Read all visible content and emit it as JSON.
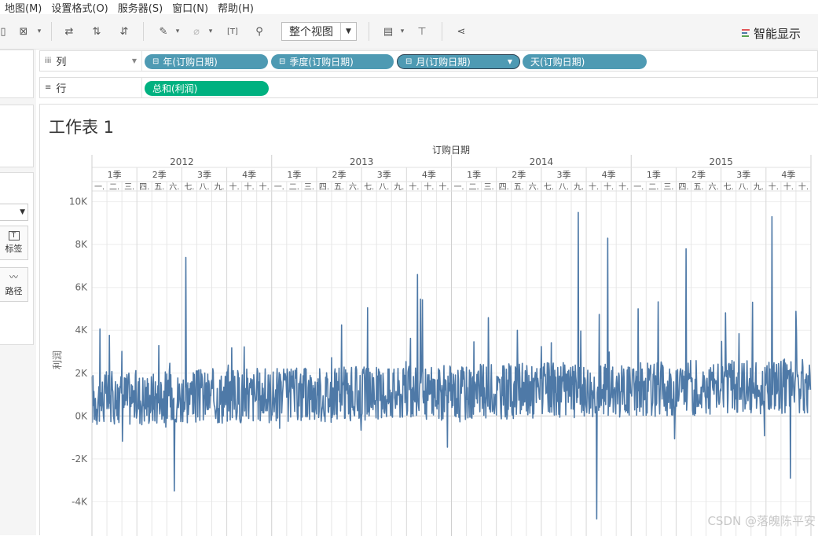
{
  "menu": [
    "地图(M)",
    "设置格式(O)",
    "服务器(S)",
    "窗口(N)",
    "帮助(H)"
  ],
  "toolbar": {
    "fit_label": "整个视图",
    "show_me_label": "智能显示",
    "show_me_colors": [
      "#e15759",
      "#4e79a7",
      "#59a14f"
    ]
  },
  "left_panel": {
    "label_button": "标签",
    "path_button": "路径"
  },
  "columns_shelf": {
    "label": "列",
    "pills": [
      "年(订购日期)",
      "季度(订购日期)",
      "月(订购日期)",
      "天(订购日期)"
    ]
  },
  "rows_shelf": {
    "label": "行",
    "pills": [
      "总和(利润)"
    ]
  },
  "sheet": {
    "title": "工作表 1",
    "watermark": "CSDN @落魄陈平安"
  },
  "colors": {
    "line": "#4e79a7",
    "pill_discrete": "#4e9ab3",
    "pill_measure": "#00b180"
  },
  "chart_data": {
    "type": "line",
    "title": "",
    "header_title": "订购日期",
    "xlabel": "订购日期",
    "ylabel": "利润",
    "years": [
      "2012",
      "2013",
      "2014",
      "2015"
    ],
    "quarters": [
      "1季",
      "2季",
      "3季",
      "4季"
    ],
    "month_labels": [
      "一.",
      "二.",
      "三.",
      "四.",
      "五.",
      "六.",
      "七.",
      "八.",
      "九.",
      "十.",
      "十.",
      "十."
    ],
    "y_ticks": [
      -4000,
      -2000,
      0,
      2000,
      4000,
      6000,
      8000,
      10000
    ],
    "y_tick_labels": [
      "-4K",
      "-2K",
      "0K",
      "2K",
      "4K",
      "6K",
      "8K",
      "10K"
    ],
    "ylim": [
      -5600,
      10500
    ],
    "grid": "vertical month lines and horizontal value lines",
    "series": [
      {
        "values_summary": "one daily-profit value per order date, 2012-2015, mostly between -1000 and 3000",
        "peaks": [
          {
            "x": "2012-07",
            "y": 7400
          },
          {
            "x": "2012-06",
            "y": -3500
          },
          {
            "x": "2013-10",
            "y": 6600
          },
          {
            "x": "2014-09",
            "y": 9500
          },
          {
            "x": "2014-10",
            "y": -4800
          },
          {
            "x": "2014-11",
            "y": 8300
          },
          {
            "x": "2015-04",
            "y": 7800
          },
          {
            "x": "2015-10",
            "y": 9300
          },
          {
            "x": "2015-11",
            "y": -2900
          }
        ]
      }
    ]
  }
}
